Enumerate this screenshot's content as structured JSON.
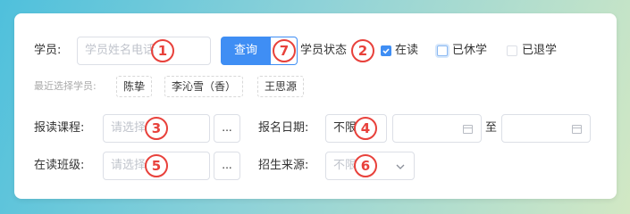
{
  "row1": {
    "student_label": "学员:",
    "student_input_placeholder": "学员姓名电话",
    "query_label": "查询",
    "status_label": "学员状态",
    "status_options": [
      {
        "label": "在读",
        "checked": true
      },
      {
        "label": "已休学",
        "checked": false
      },
      {
        "label": "已退学",
        "checked": false
      }
    ]
  },
  "recent": {
    "label": "最近选择学员:",
    "students": [
      "陈挚",
      "李沁雪（香）",
      "王思源"
    ]
  },
  "row2": {
    "course_label": "报读课程:",
    "course_placeholder": "请选择",
    "dots_label": "...",
    "signup_date_label": "报名日期:",
    "date_mode_value": "不限",
    "to_label": "至"
  },
  "row3": {
    "class_label": "在读班级:",
    "class_placeholder": "请选择",
    "dots_label": "...",
    "source_label": "招生来源:",
    "source_value": "不限"
  },
  "annotations": [
    "1",
    "2",
    "3",
    "4",
    "5",
    "6",
    "7"
  ],
  "colors": {
    "accent": "#3f8ef4",
    "annotation": "#e8413b"
  }
}
